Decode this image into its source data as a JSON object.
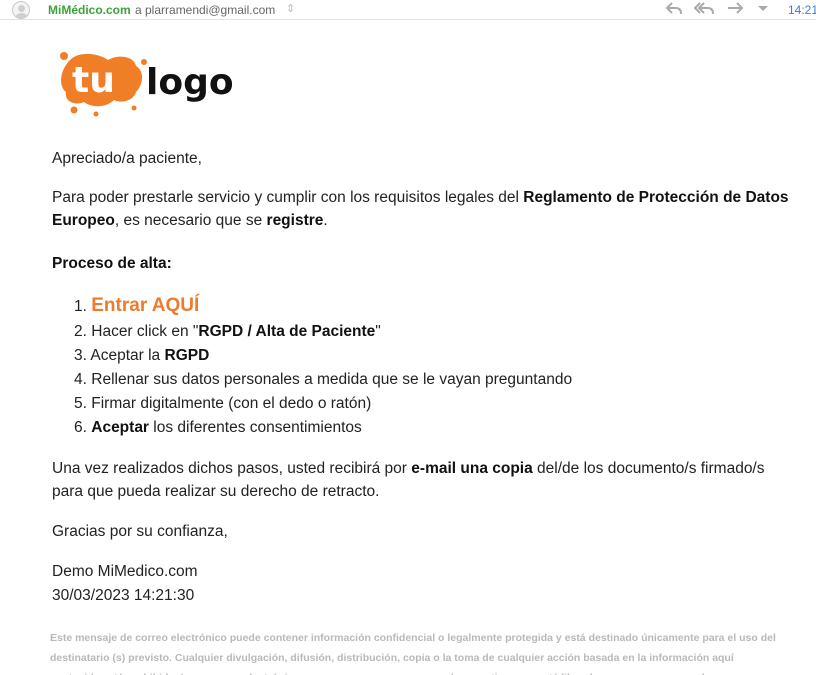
{
  "header": {
    "sender": "MiMédico.com",
    "recipient": "a plarramendi@gmail.com",
    "time": "14:21",
    "icons": [
      "reply-icon",
      "reply-all-icon",
      "forward-icon",
      "more-dropdown-icon"
    ]
  },
  "logo": {
    "part1": "tu",
    "part2": "logo",
    "accent": "#F07E26"
  },
  "email": {
    "greeting": "Apreciado/a paciente,",
    "intro_1": "Para poder prestarle servicio y cumplir con los requisitos legales del ",
    "intro_bold_1": "Reglamento de Protección de Datos Europeo",
    "intro_2": ", es necesario que se ",
    "intro_bold_2": "registre",
    "intro_3": ".",
    "process_heading": "Proceso de alta:",
    "steps": {
      "s1_num": "1.",
      "s1_link": "Entrar AQUÍ",
      "s2_num": "2.",
      "s2_pre": "Hacer click en \"",
      "s2_bold": "RGPD / Alta de Paciente",
      "s2_post": "\"",
      "s3_num": "3.",
      "s3_pre": "Aceptar la ",
      "s3_bold": "RGPD",
      "s4_num": "4.",
      "s4_text": "Rellenar sus datos personales a medida que se le vayan preguntando",
      "s5_num": "5.",
      "s5_text": "Firmar digitalmente (con el dedo o ratón)",
      "s6_num": "6.",
      "s6_bold": "Aceptar",
      "s6_post": " los diferentes consentimientos"
    },
    "outro_1": "Una vez realizados dichos pasos, usted recibirá por ",
    "outro_bold": "e-mail una copia",
    "outro_2": " del/de los documento/s firmado/s para que pueda realizar su derecho de retracto.",
    "thanks": "Gracias por su confianza,",
    "signature_name": "Demo MiMedico.com",
    "signature_date": "30/03/2023 14:21:30",
    "disclaimer": "Este mensaje de correo electrónico puede contener información confidencial o legalmente protegida y está destinado únicamente para el uso del destinatario (s) previsto. Cualquier divulgación, difusión, distribución, copia o la toma de cualquier acción basada en la información aquí contenida está prohibido. Los correos electrónicos no son seguros y no se puede garantizar que esté libre de errores, ya que pueden ser interceptados, modificados, o"
  },
  "colors": {
    "sender": "#3AA23A",
    "time": "#3A7EC4",
    "cta": "#EF7A2D",
    "disclaimer": "#B9B9B9"
  }
}
